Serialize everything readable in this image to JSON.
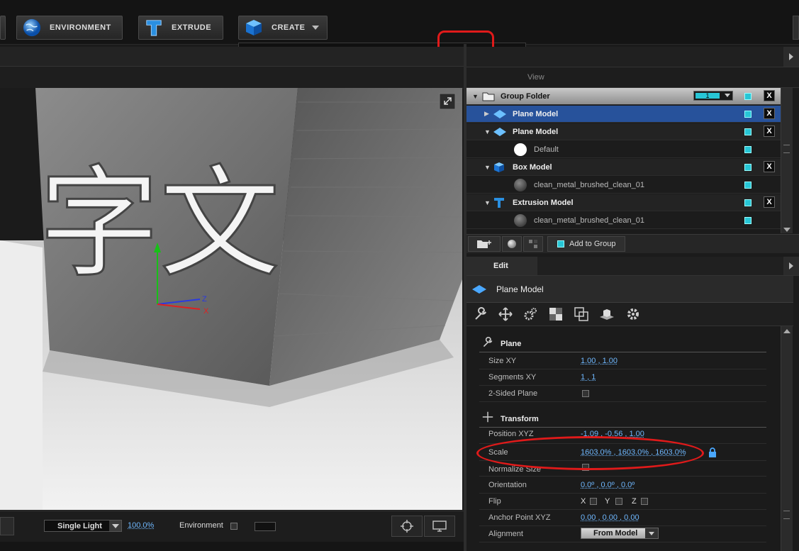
{
  "toolbar": {
    "environment_label": "ENVIRONMENT",
    "extrude_label": "EXTRUDE",
    "create_label": "CREATE"
  },
  "palette": {
    "items": [
      "box-shape",
      "sphere-shape",
      "cylinder-shape",
      "tube-shape",
      "torus-shape",
      "cone-shape",
      "plane-shape",
      "cylinder-cap-shape"
    ],
    "selected": "plane-shape"
  },
  "scene_panel": {
    "view_tab": "View",
    "rows": [
      {
        "label": "Group Folder",
        "type": "folder",
        "counter": "1"
      },
      {
        "label": "Plane Model",
        "type": "model",
        "selected": true
      },
      {
        "label": "Plane Model",
        "type": "model"
      },
      {
        "label": "Default",
        "type": "material"
      },
      {
        "label": "Box Model",
        "type": "model"
      },
      {
        "label": "clean_metal_brushed_clean_01",
        "type": "material"
      },
      {
        "label": "Extrusion Model",
        "type": "model"
      },
      {
        "label": "clean_metal_brushed_clean_01",
        "type": "material"
      }
    ],
    "add_to_group": "Add to Group",
    "x_label": "X"
  },
  "edit_panel": {
    "tab": "Edit",
    "title": "Plane Model",
    "plane_section": "Plane",
    "transform_section": "Transform",
    "props": {
      "size_xy": {
        "label": "Size XY",
        "value": "1.00 ,  1.00"
      },
      "segments_xy": {
        "label": "Segments XY",
        "value": "1 ,  1"
      },
      "two_sided": {
        "label": "2-Sided Plane"
      },
      "position": {
        "label": "Position XYZ",
        "value": "-1.09 ,  -0.56 ,  1.00"
      },
      "scale": {
        "label": "Scale",
        "value": "1603.0% ,  1603.0% ,  1603.0%"
      },
      "normalize": {
        "label": "Normalize Size"
      },
      "orientation": {
        "label": "Orientation",
        "value": "0.0º ,  0.0º ,  0.0º"
      },
      "flip": {
        "label": "Flip",
        "x": "X",
        "y": "Y",
        "z": "Z"
      },
      "anchor": {
        "label": "Anchor Point XYZ",
        "value": "0.00 ,  0.00 ,  0.00"
      },
      "alignment": {
        "label": "Alignment",
        "value": "From Model"
      }
    }
  },
  "viewport": {
    "glyphs": "字文",
    "axis_z": "Z",
    "axis_x": "X"
  },
  "bottom": {
    "light_mode": "Single Light",
    "zoom": "100.0%",
    "environment_label": "Environment"
  }
}
